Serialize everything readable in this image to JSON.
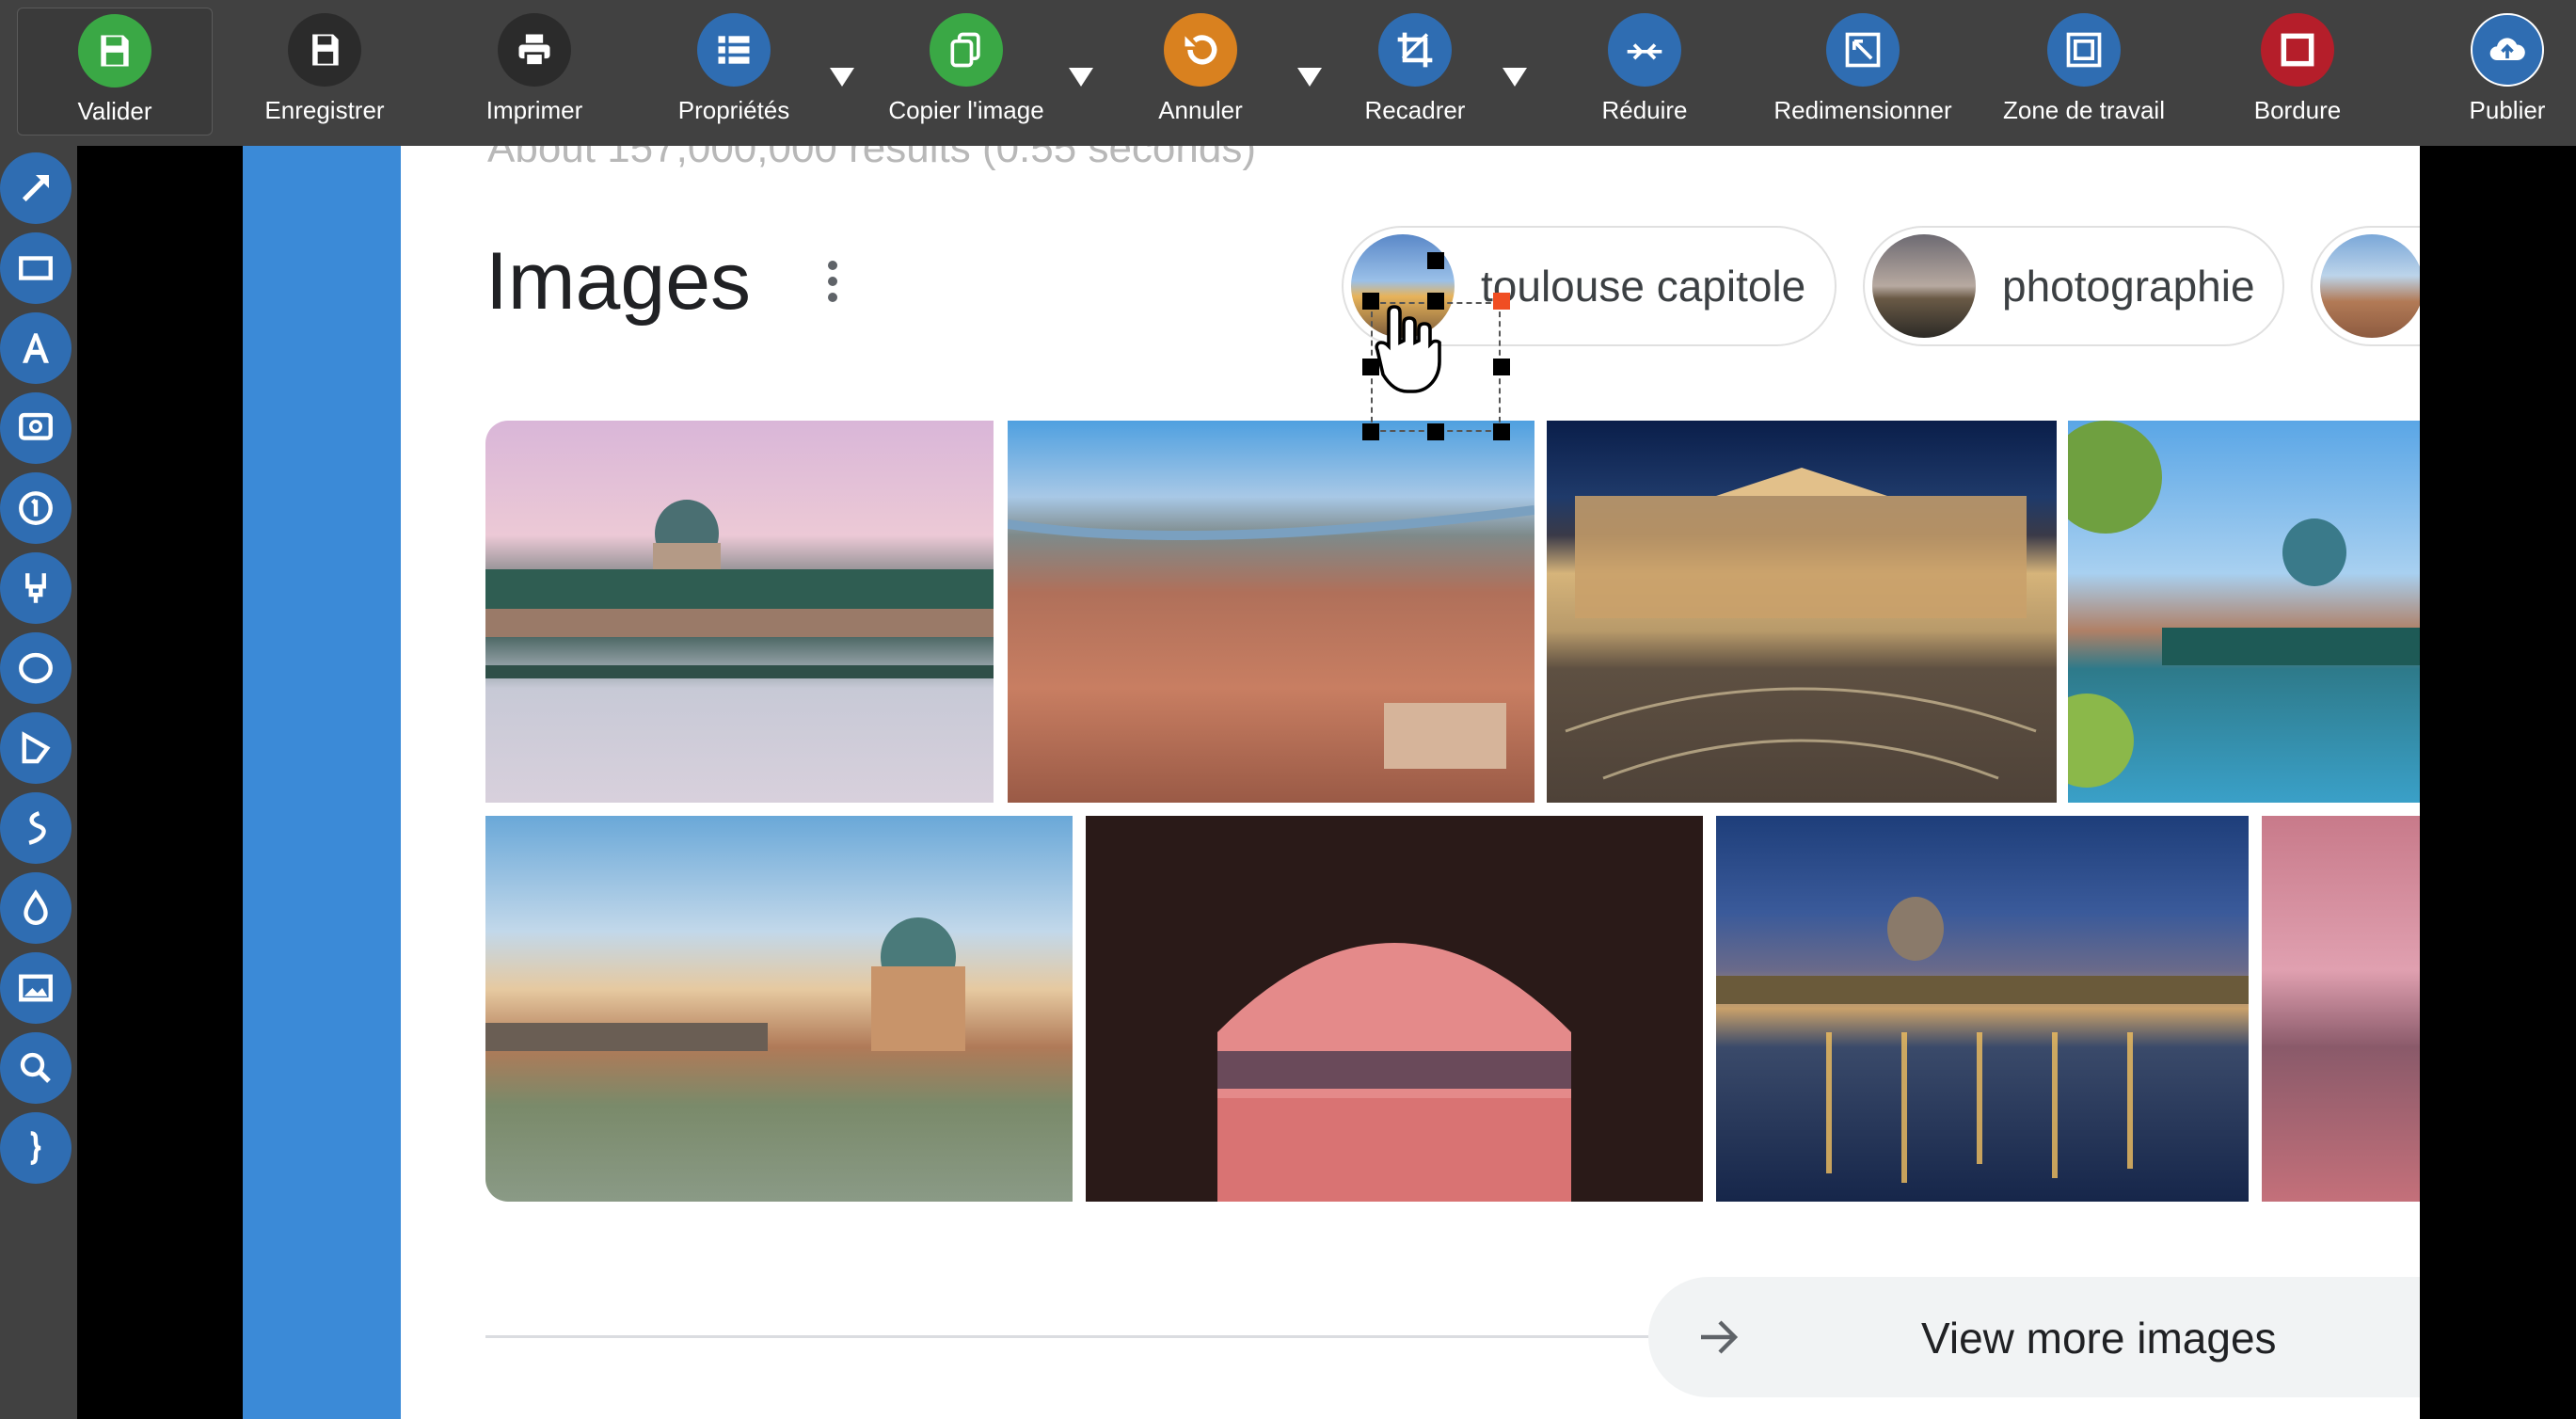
{
  "toolbar": {
    "buttons": [
      {
        "label": "Valider",
        "icon": "floppy-disk-icon",
        "color": "#3aa845"
      },
      {
        "label": "Enregistrer",
        "icon": "save-as-icon",
        "color": "#2b2b2b"
      },
      {
        "label": "Imprimer",
        "icon": "printer-icon",
        "color": "#2b2b2b"
      },
      {
        "label": "Propriétés",
        "icon": "list-icon",
        "color": "#2f6db2"
      },
      {
        "label": "Copier l'image",
        "icon": "copy-icon",
        "color": "#3aa845"
      },
      {
        "label": "Annuler",
        "icon": "undo-icon",
        "color": "#d9811f"
      },
      {
        "label": "Recadrer",
        "icon": "crop-icon",
        "color": "#2f6db2"
      },
      {
        "label": "Réduire",
        "icon": "compress-icon",
        "color": "#2f6db2"
      },
      {
        "label": "Redimensionner",
        "icon": "resize-icon",
        "color": "#2f6db2"
      },
      {
        "label": "Zone de travail",
        "icon": "canvas-area-icon",
        "color": "#2f6db2"
      },
      {
        "label": "Bordure",
        "icon": "border-icon",
        "color": "#b51e2a"
      },
      {
        "label": "Publier",
        "icon": "cloud-upload-icon",
        "color": "#2f6db2"
      }
    ]
  },
  "sidebar": {
    "tools": [
      "arrow-tool-icon",
      "rectangle-tool-icon",
      "text-tool-icon",
      "caption-tool-icon",
      "step-number-tool-icon",
      "highlighter-tool-icon",
      "ellipse-tool-icon",
      "polygon-tool-icon",
      "freehand-tool-icon",
      "blur-tool-icon",
      "image-tool-icon",
      "magnify-tool-icon",
      "brace-tool-icon"
    ]
  },
  "page": {
    "results_text": "About 157,000,000 results (0.55 seconds)",
    "images_title": "Images",
    "chips": [
      {
        "label": "toulouse capitole"
      },
      {
        "label": "photographie"
      },
      {
        "label": ""
      }
    ],
    "more_images_label": "View more images"
  }
}
